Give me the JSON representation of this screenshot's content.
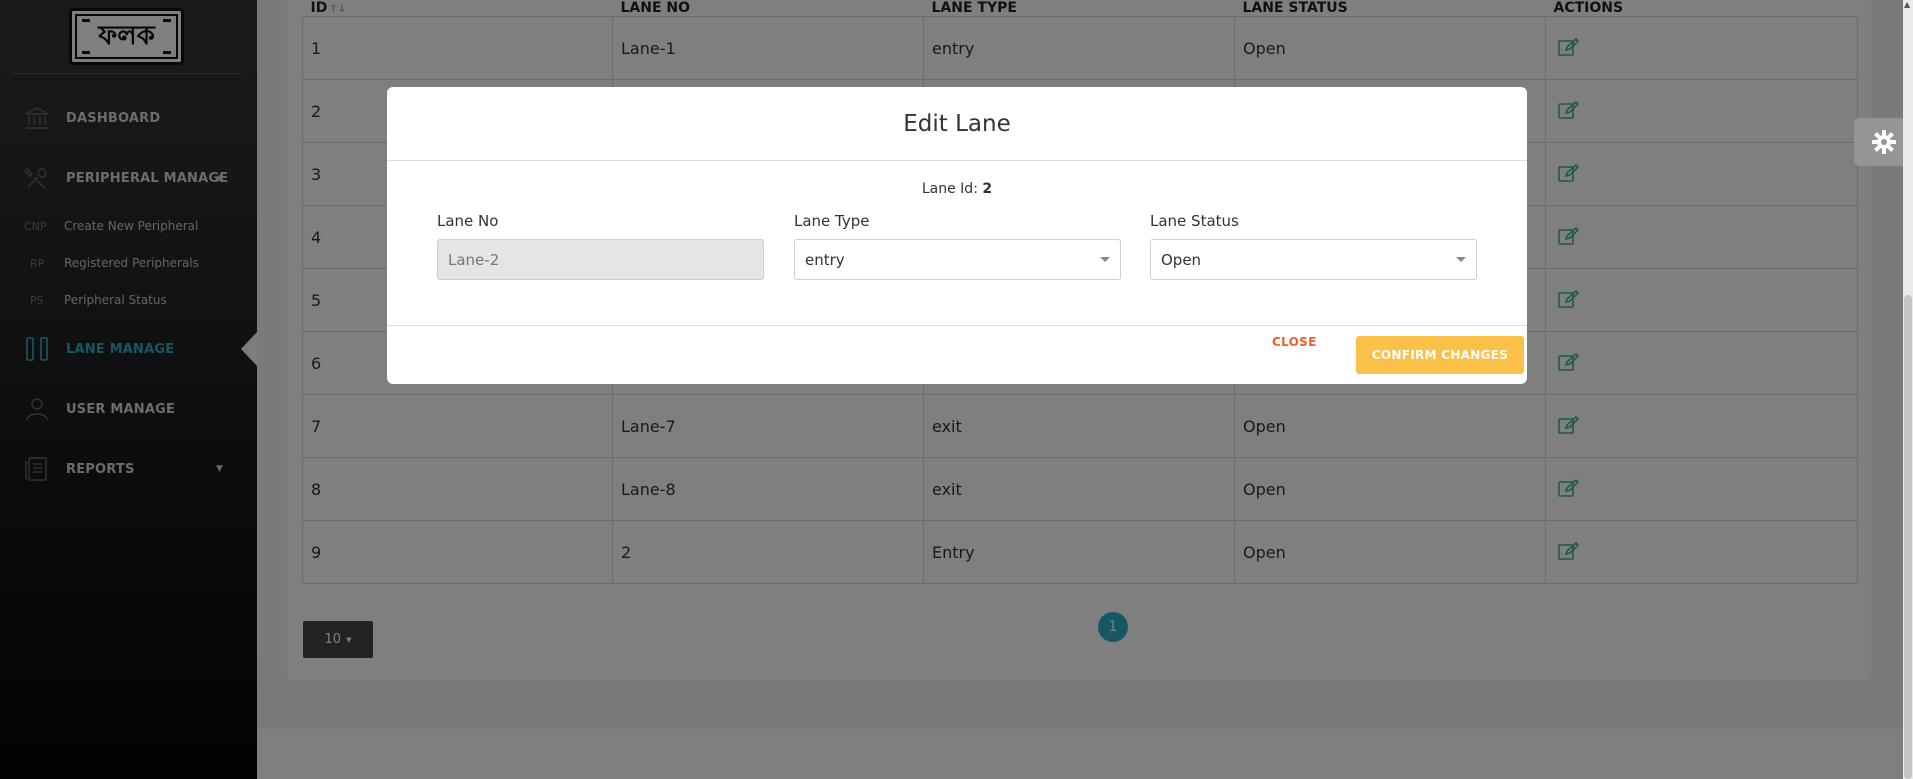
{
  "brand": {
    "logo_text": "ফলক"
  },
  "sidebar": {
    "items": [
      {
        "label": "DASHBOARD",
        "icon": "bank-icon"
      },
      {
        "label": "PERIPHERAL MANAGE",
        "icon": "tools-icon"
      },
      {
        "label": "LANE MANAGE",
        "icon": "columns-icon"
      },
      {
        "label": "USER MANAGE",
        "icon": "user-icon"
      },
      {
        "label": "REPORTS",
        "icon": "report-icon"
      }
    ],
    "sub_items": [
      {
        "abbr": "CNP",
        "label": "Create New Peripheral"
      },
      {
        "abbr": "RP",
        "label": "Registered Peripherals"
      },
      {
        "abbr": "PS",
        "label": "Peripheral Status"
      }
    ]
  },
  "table": {
    "headers": [
      "ID",
      "LANE NO",
      "LANE TYPE",
      "LANE STATUS",
      "ACTIONS"
    ],
    "rows": [
      {
        "id": "1",
        "lane_no": "Lane-1",
        "lane_type": "entry",
        "lane_status": "Open"
      },
      {
        "id": "2",
        "lane_no": "",
        "lane_type": "",
        "lane_status": ""
      },
      {
        "id": "3",
        "lane_no": "",
        "lane_type": "",
        "lane_status": ""
      },
      {
        "id": "4",
        "lane_no": "",
        "lane_type": "",
        "lane_status": ""
      },
      {
        "id": "5",
        "lane_no": "",
        "lane_type": "",
        "lane_status": ""
      },
      {
        "id": "6",
        "lane_no": "",
        "lane_type": "",
        "lane_status": ""
      },
      {
        "id": "7",
        "lane_no": "Lane-7",
        "lane_type": "exit",
        "lane_status": "Open"
      },
      {
        "id": "8",
        "lane_no": "Lane-8",
        "lane_type": "exit",
        "lane_status": "Open"
      },
      {
        "id": "9",
        "lane_no": "2",
        "lane_type": "Entry",
        "lane_status": "Open"
      }
    ],
    "page_size": "10",
    "current_page": "1"
  },
  "modal": {
    "title": "Edit Lane",
    "lane_id_label": "Lane Id:",
    "lane_id_value": "2",
    "lane_no_label": "Lane No",
    "lane_no_placeholder": "Lane-2",
    "lane_type_label": "Lane Type",
    "lane_type_value": "entry",
    "lane_status_label": "Lane Status",
    "lane_status_value": "Open",
    "close_label": "CLOSE",
    "confirm_label": "CONFIRM CHANGES"
  },
  "colors": {
    "accent": "#2ab1c6",
    "confirm": "#fbc047",
    "close": "#e8622a",
    "edit_icon": "#3cb878"
  }
}
